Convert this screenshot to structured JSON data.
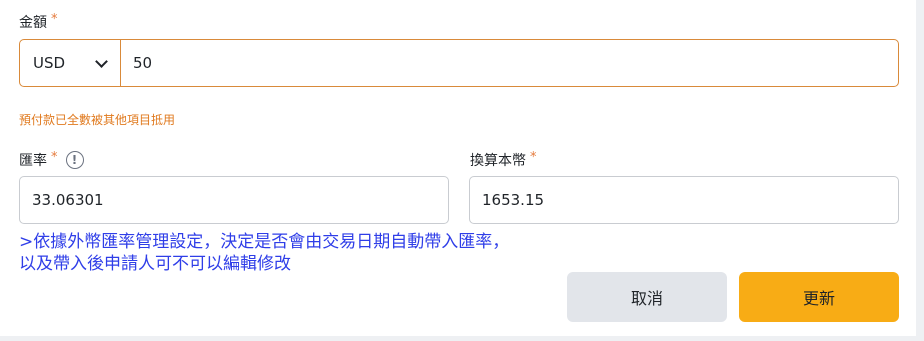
{
  "amount": {
    "label": "金額",
    "required_mark": "*",
    "currency": "USD",
    "value": "50"
  },
  "warning": "預付款已全數被其他項目抵用",
  "exchange_rate": {
    "label": "匯率",
    "required_mark": "*",
    "info_icon": "!",
    "value": "33.06301"
  },
  "converted": {
    "label": "換算本幣",
    "required_mark": "*",
    "value": "1653.15"
  },
  "note": {
    "line1": ">依據外幣匯率管理設定，決定是否會由交易日期自動帶入匯率，",
    "line2": "以及帶入後申請人可不可以編輯修改"
  },
  "buttons": {
    "cancel": "取消",
    "update": "更新"
  },
  "colors": {
    "accent": "#f8ac15",
    "warning": "#e07a1f",
    "note": "#2f3ee8",
    "focus_border": "#d98a3a"
  },
  "icons": {
    "currency_dropdown": "chevron-down-icon",
    "rate_info": "info-icon"
  }
}
